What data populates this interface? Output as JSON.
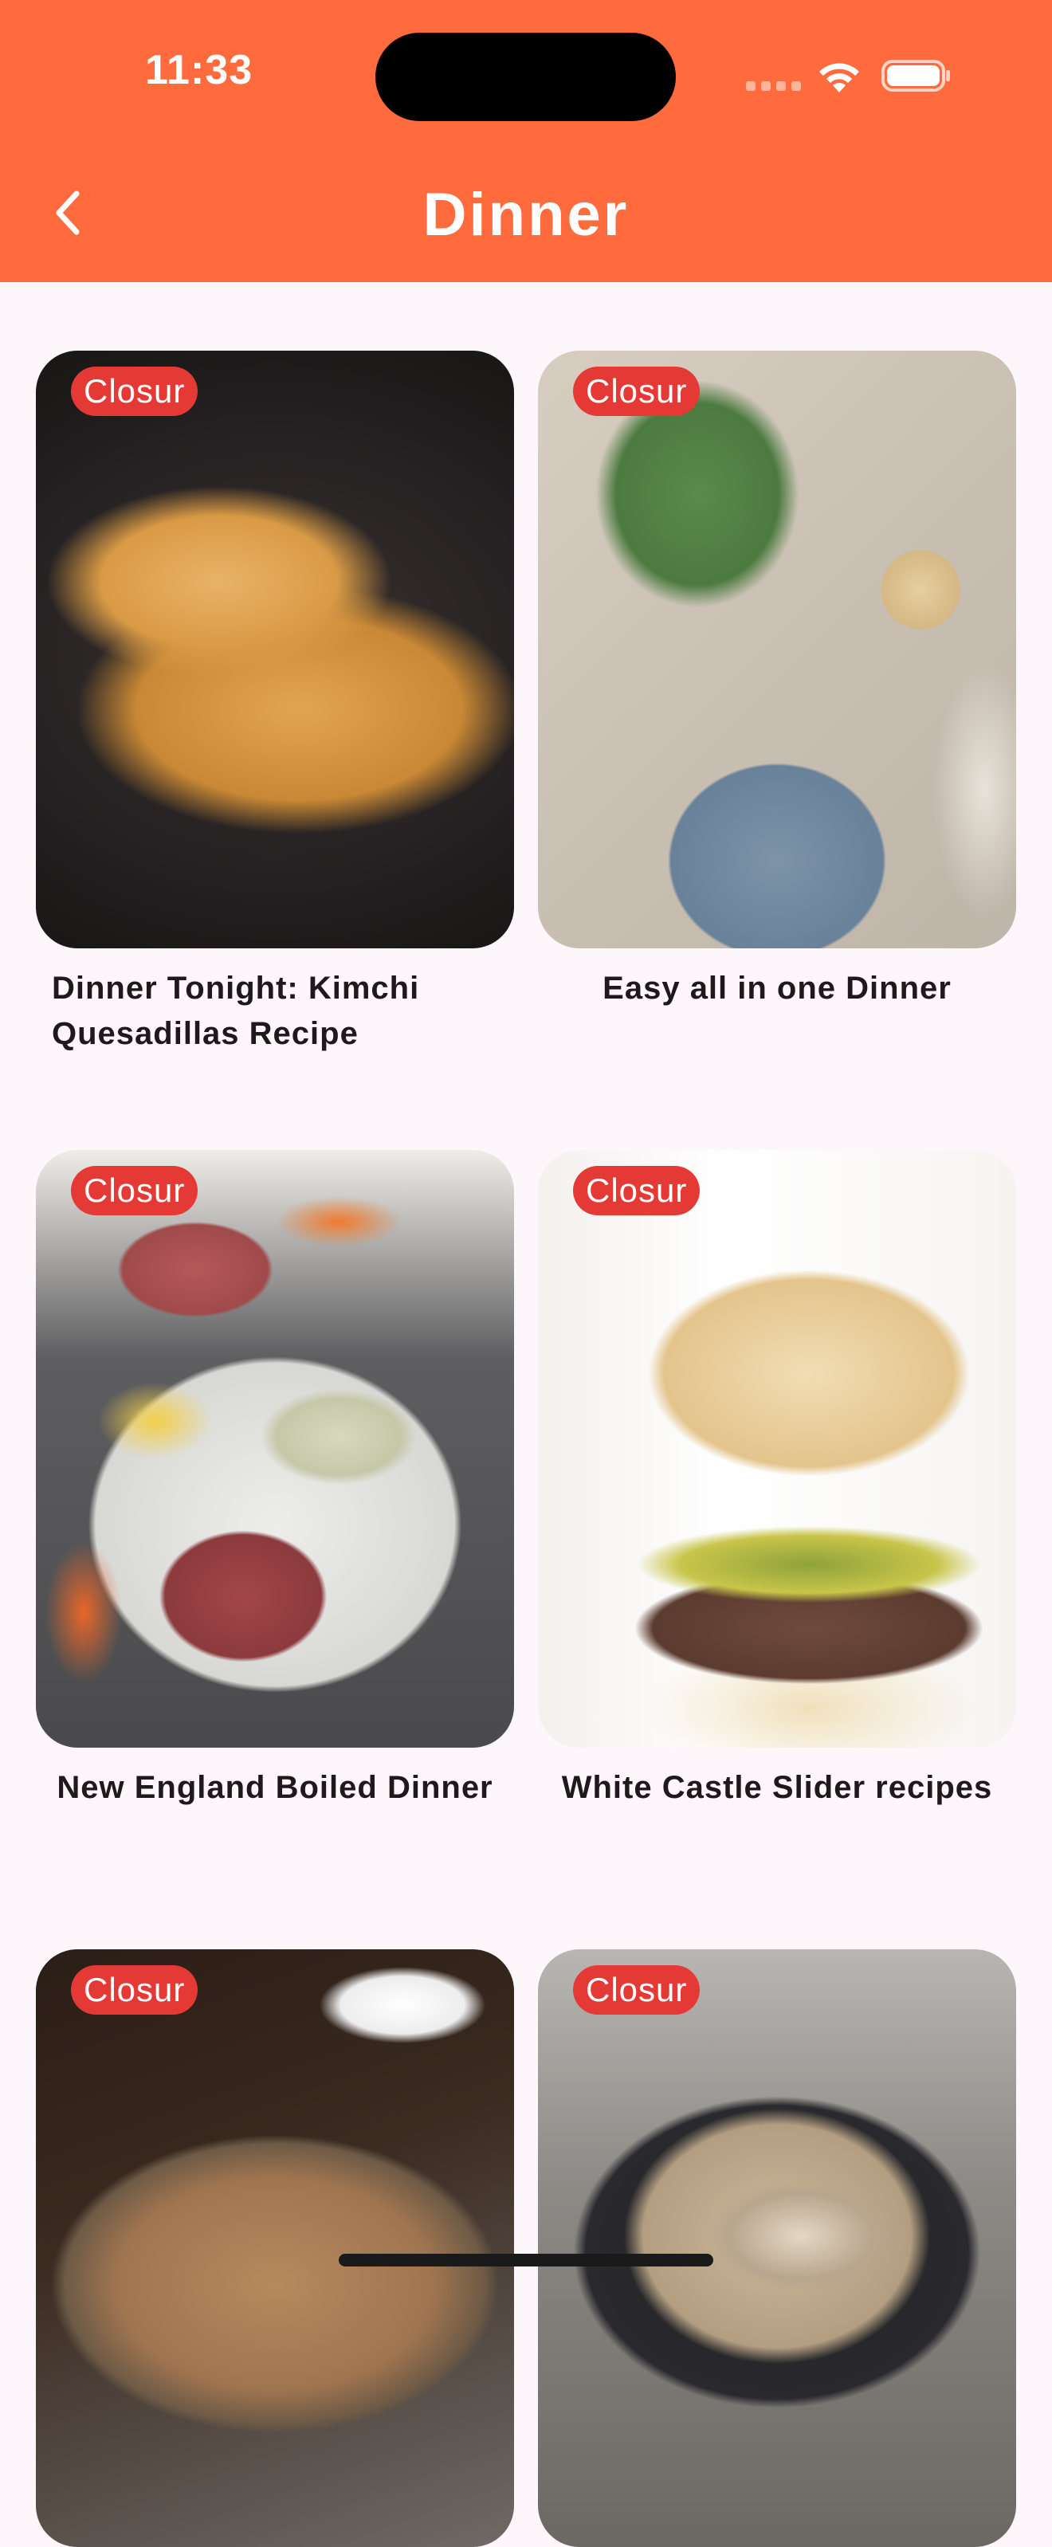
{
  "status_bar": {
    "time": "11:33"
  },
  "header": {
    "title": "Dinner",
    "back_icon": "chevron-left-icon",
    "background_color": "#FF6B3D"
  },
  "recipes": [
    {
      "badge": "Closur",
      "title": "Dinner Tonight: Kimchi Quesadillas Recipe"
    },
    {
      "badge": "Closur",
      "title": "Easy all in one Dinner"
    },
    {
      "badge": "Closur",
      "title": "New England Boiled Dinner"
    },
    {
      "badge": "Closur",
      "title": "White Castle Slider recipes"
    },
    {
      "badge": "Closur",
      "title": ""
    },
    {
      "badge": "Closur",
      "title": ""
    }
  ],
  "colors": {
    "badge": "#E53935",
    "page_background": "#FDF7FC"
  }
}
